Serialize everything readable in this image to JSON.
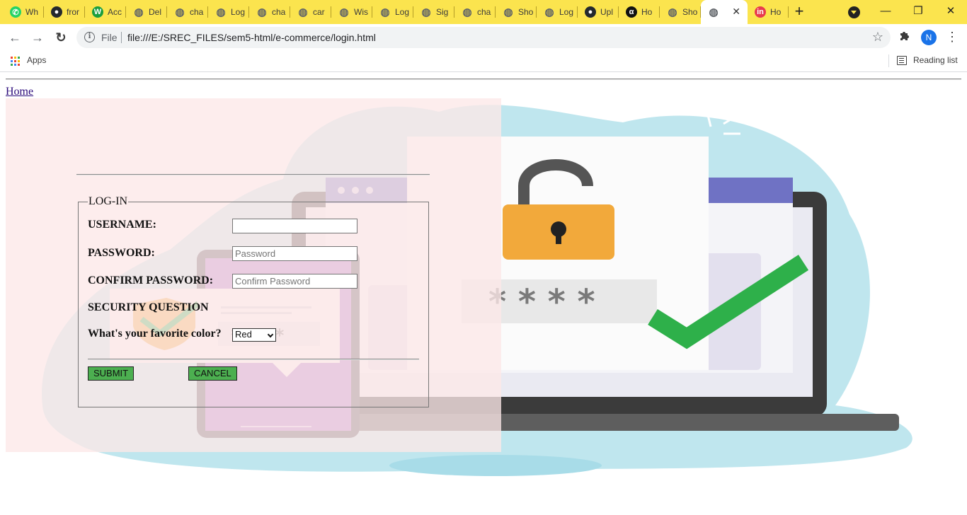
{
  "browser": {
    "tabs": [
      {
        "title": "Wh",
        "icon": "whatsapp-icon",
        "icon_color": "#25d366",
        "glyph": "✆"
      },
      {
        "title": "fror",
        "icon": "github-icon",
        "icon_color": "#24292e",
        "glyph": "●"
      },
      {
        "title": "Acc",
        "icon": "w-logo-icon",
        "icon_color": "#1a9e3f",
        "glyph": "W"
      },
      {
        "title": "Del",
        "icon": "globe-icon",
        "icon_color": "#5f6368",
        "glyph": "◍"
      },
      {
        "title": "cha",
        "icon": "globe-icon",
        "icon_color": "#5f6368",
        "glyph": "◍"
      },
      {
        "title": "Log",
        "icon": "globe-icon",
        "icon_color": "#5f6368",
        "glyph": "◍"
      },
      {
        "title": "cha",
        "icon": "globe-icon",
        "icon_color": "#5f6368",
        "glyph": "◍"
      },
      {
        "title": "car",
        "icon": "globe-icon",
        "icon_color": "#5f6368",
        "glyph": "◍"
      },
      {
        "title": "Wis",
        "icon": "globe-icon",
        "icon_color": "#5f6368",
        "glyph": "◍"
      },
      {
        "title": "Log",
        "icon": "globe-icon",
        "icon_color": "#5f6368",
        "glyph": "◍"
      },
      {
        "title": "Sig",
        "icon": "globe-icon",
        "icon_color": "#5f6368",
        "glyph": "◍"
      },
      {
        "title": "cha",
        "icon": "globe-icon",
        "icon_color": "#5f6368",
        "glyph": "◍"
      },
      {
        "title": "Sho",
        "icon": "globe-icon",
        "icon_color": "#5f6368",
        "glyph": "◍"
      },
      {
        "title": "Log",
        "icon": "globe-icon",
        "icon_color": "#5f6368",
        "glyph": "◍"
      },
      {
        "title": "Upl",
        "icon": "github-icon",
        "icon_color": "#24292e",
        "glyph": "●"
      },
      {
        "title": "Ho",
        "icon": "alpha-logo-icon",
        "icon_color": "#111111",
        "glyph": "α"
      },
      {
        "title": "Sho",
        "icon": "globe-icon",
        "icon_color": "#5f6368",
        "glyph": "◍"
      },
      {
        "title": "",
        "icon": "globe-icon",
        "icon_color": "#5f6368",
        "glyph": "◍",
        "active": true
      },
      {
        "title": "Ho",
        "icon": "invision-icon",
        "icon_color": "#e8394d",
        "glyph": "in"
      }
    ],
    "new_tab_symbol": "+",
    "window_controls": {
      "minimize": "—",
      "restore": "❐",
      "close": "✕"
    },
    "nav": {
      "back": "←",
      "forward": "→",
      "reload": "↻"
    },
    "address": {
      "scheme_label": "File",
      "url": "file:///E:/SREC_FILES/sem5-html/e-commerce/login.html"
    },
    "profile_initial": "N",
    "bookmarks": {
      "apps_label": "Apps",
      "reading_list_label": "Reading list"
    },
    "colors": {
      "tabstrip": "#fbe44e",
      "profile": "#1a73e8"
    }
  },
  "page": {
    "home_link": "Home",
    "form": {
      "legend": "LOG-IN",
      "username_label": "USERNAME:",
      "username_value": "",
      "password_label": "PASSWORD:",
      "password_placeholder": "Password",
      "confirm_label": "CONFIRM PASSWORD:",
      "confirm_placeholder": "Confirm Password",
      "security_heading": "SECURITY QUESTION",
      "color_question": "What's your favorite color?",
      "color_selected": "Red",
      "submit_label": "SUBMIT",
      "cancel_label": "CANCEL"
    },
    "illustration": {
      "password_mask": "* * * *",
      "phone_mask": "* * * *"
    },
    "colors": {
      "button_green": "#4caf50",
      "link": "#2a0a7a",
      "blob": "#bfe6ee"
    }
  }
}
